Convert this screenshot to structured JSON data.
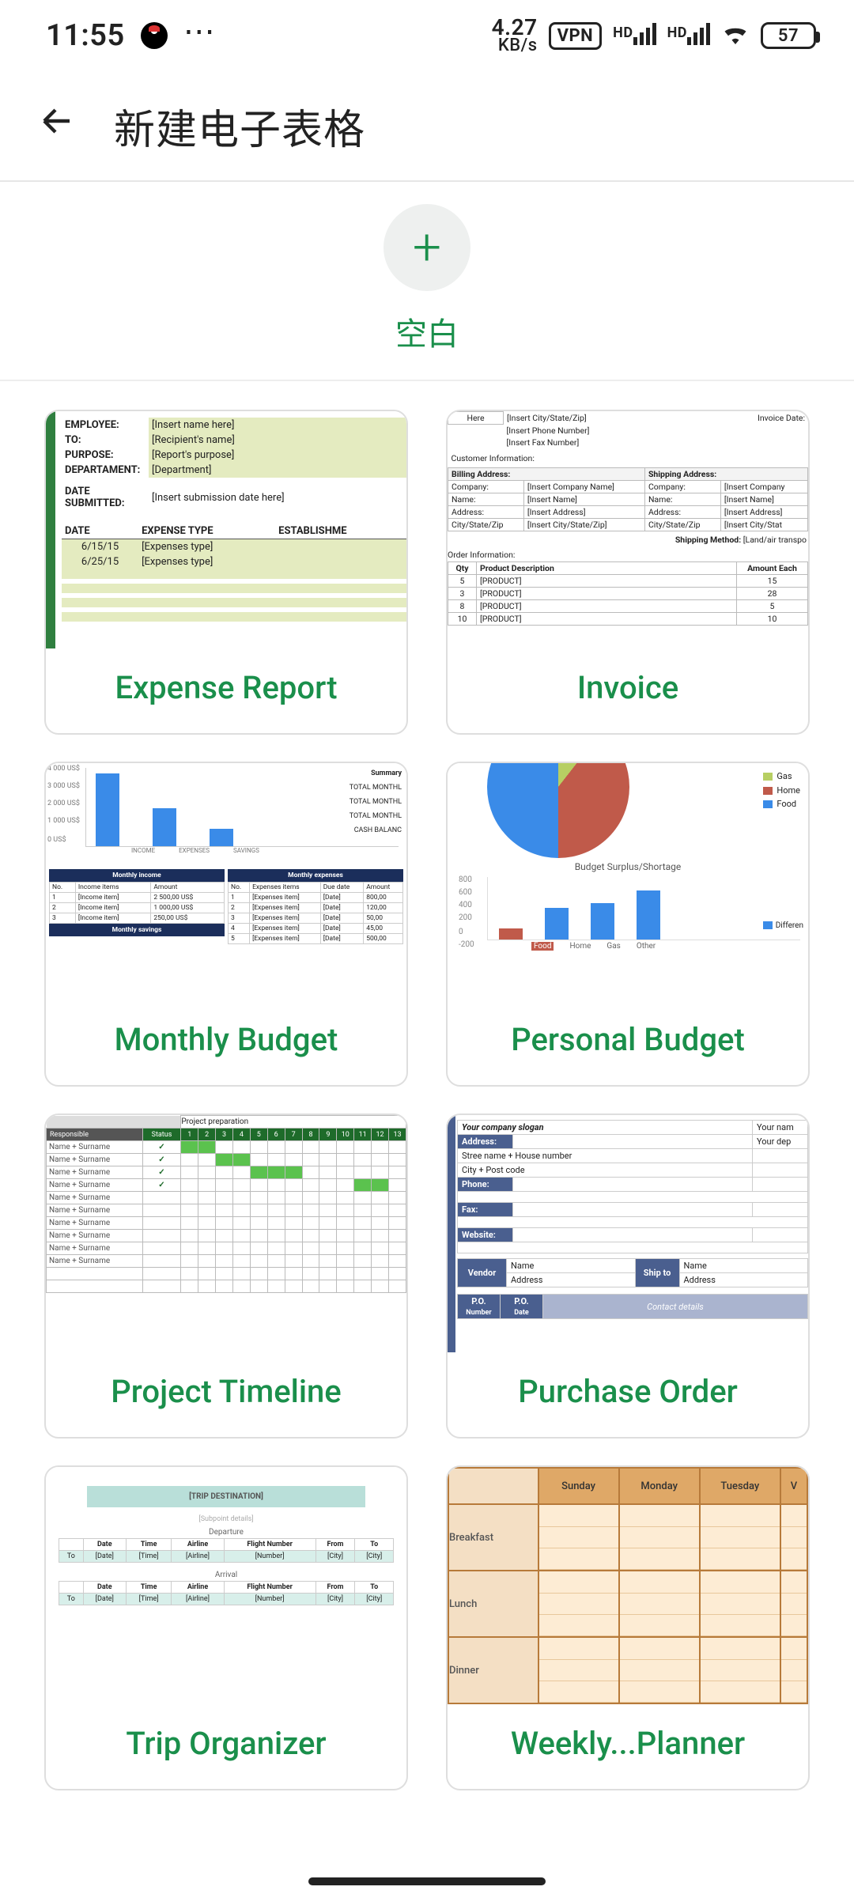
{
  "status": {
    "time": "11:55",
    "netRate": "4.27",
    "netUnit": "KB/s",
    "vpn": "VPN",
    "hd": "HD",
    "battery": "57"
  },
  "header": {
    "title": "新建电子表格"
  },
  "blank": {
    "label": "空白"
  },
  "templates": [
    {
      "label": "Expense Report"
    },
    {
      "label": "Invoice"
    },
    {
      "label": "Monthly Budget"
    },
    {
      "label": "Personal Budget"
    },
    {
      "label": "Project Timeline"
    },
    {
      "label": "Purchase Order"
    },
    {
      "label": "Trip Organizer"
    },
    {
      "label": "Weekly...Planner"
    }
  ],
  "thumbs": {
    "expense": {
      "employee": "EMPLOYEE:",
      "employee_v": "[Insert name here]",
      "to": "TO:",
      "to_v": "[Recipient's name]",
      "purpose": "PURPOSE:",
      "purpose_v": "[Report's purpose]",
      "dept": "DEPARTAMENT:",
      "dept_v": "[Department]",
      "subm": "DATE SUBMITTED:",
      "subm_v": "[Insert submission date here]",
      "h_date": "DATE",
      "h_type": "EXPENSE TYPE",
      "h_est": "ESTABLISHME",
      "d1": "6/15/15",
      "d2": "6/25/15",
      "t1": "[Expenses type]",
      "t2": "[Expenses type]"
    },
    "invoice": {
      "here": "Here",
      "csz": "[Insert City/State/Zip]",
      "phone": "[Insert Phone Number]",
      "fax": "[Insert Fax Number]",
      "invdate": "Invoice Date:",
      "cust": "Customer Information:",
      "bill": "Billing Address:",
      "ship": "Shipping Address:",
      "comp": "Company:",
      "name": "Name:",
      "addr": "Address:",
      "cszl": "City/State/Zip",
      "icomp": "[Insert Company Name]",
      "iname": "[Insert Name]",
      "iaddr": "[Insert Address]",
      "icsz": "[Insert City/State/Zip]",
      "icompS": "[Insert Company",
      "icszS": "[Insert City/Stat",
      "smeth": "Shipping Method:",
      "smethv": "[Land/air transpo",
      "order": "Order Information:",
      "qty": "Qty",
      "pdesc": "Product Description",
      "amt": "Amount Each",
      "q": [
        "5",
        "3",
        "8",
        "10"
      ],
      "p": "[PRODUCT]",
      "a": [
        "15",
        "28",
        "5",
        "10"
      ]
    },
    "monthly": {
      "summary": "Summary",
      "tm": "TOTAL MONTHL",
      "cash": "CASH BALANC",
      "y": [
        "4 000 US$",
        "3 000 US$",
        "2 000 US$",
        "1 000 US$",
        "0 US$"
      ],
      "x": [
        "INCOME",
        "EXPENSES",
        "SAVINGS"
      ],
      "ti": "Monthly income",
      "te": "Monthly expenses",
      "ts": "Monthly savings",
      "iH": [
        "No.",
        "Income items",
        "Amount"
      ],
      "eH": [
        "No.",
        "Expenses items",
        "Due date",
        "Amount"
      ],
      "iR": [
        [
          "1",
          "[Income item]",
          "2 500,00 US$"
        ],
        [
          "2",
          "[Income item]",
          "1 000,00 US$"
        ],
        [
          "3",
          "[Income item]",
          "250,00 US$"
        ]
      ],
      "eR": [
        [
          "1",
          "[Expenses item]",
          "[Date]",
          "800,00"
        ],
        [
          "2",
          "[Expenses item]",
          "[Date]",
          "120,00"
        ],
        [
          "3",
          "[Expenses item]",
          "[Date]",
          "50,00"
        ],
        [
          "4",
          "[Expenses item]",
          "[Date]",
          "45,00"
        ],
        [
          "5",
          "[Expenses item]",
          "[Date]",
          "500,00"
        ]
      ]
    },
    "personal": {
      "leg": [
        "Gas",
        "Home",
        "Food"
      ],
      "title": "Budget Surplus/Shortage",
      "y": [
        "800",
        "600",
        "400",
        "200",
        "0",
        "-200"
      ],
      "x": [
        "Food",
        "Home",
        "Gas",
        "Other"
      ],
      "diff": "Differen"
    },
    "timeline": {
      "title": "Project preparation",
      "resp": "Responsible",
      "stat": "Status",
      "cols": [
        "1",
        "2",
        "3",
        "4",
        "5",
        "6",
        "7",
        "8",
        "9",
        "10",
        "11",
        "12",
        "13"
      ],
      "row": "Name + Surname"
    },
    "po": {
      "slogan": "Your company slogan",
      "yn": "Your nam",
      "yd": "Your dep",
      "addr": "Address:",
      "street": "Stree name + House number",
      "city": "City + Post code",
      "phone": "Phone:",
      "fax": "Fax:",
      "web": "Website:",
      "vendor": "Vendor",
      "name": "Name",
      "address": "Address",
      "shipto": "Ship to",
      "pono": "P.O.",
      "pon": "Number",
      "pod": "Date",
      "cd": "Contact details"
    },
    "trip": {
      "dest": "[TRIP DESTINATION]",
      "sub": "[Subpoint details]",
      "dep": "Departure",
      "arr": "Arrival",
      "h": [
        "Date",
        "Time",
        "Airline",
        "Flight Number",
        "From",
        "To"
      ],
      "r": [
        "[Date]",
        "[Time]",
        "[Airline]",
        "[Number]",
        "[City]",
        "[City]"
      ]
    },
    "weekly": {
      "days": [
        "Sunday",
        "Monday",
        "Tuesday",
        "V"
      ],
      "meals": [
        "Breakfast",
        "Lunch",
        "Dinner"
      ]
    }
  }
}
